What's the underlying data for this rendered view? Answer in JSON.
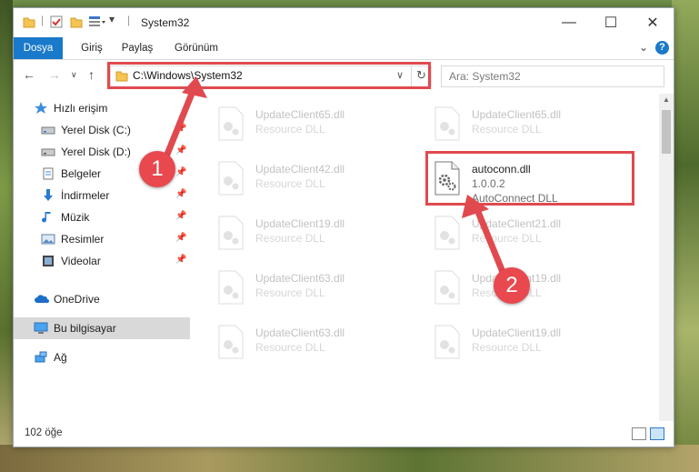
{
  "window": {
    "title": "System32",
    "controls": {
      "minimize": "—",
      "maximize": "☐",
      "close": "✕"
    }
  },
  "ribbon": {
    "tabs": [
      "Dosya",
      "Giriş",
      "Paylaş",
      "Görünüm"
    ]
  },
  "nav": {
    "address": "C:\\Windows\\System32",
    "search_placeholder": "Ara: System32"
  },
  "sidebar": {
    "items": [
      {
        "label": "Hızlı erişim",
        "icon": "star-icon"
      },
      {
        "label": "Yerel Disk (C:)",
        "icon": "drive-icon",
        "pinned": true
      },
      {
        "label": "Yerel Disk (D:)",
        "icon": "drive-icon",
        "pinned": true
      },
      {
        "label": "Belgeler",
        "icon": "documents-icon",
        "pinned": true
      },
      {
        "label": "İndirmeler",
        "icon": "download-icon",
        "pinned": true
      },
      {
        "label": "Müzik",
        "icon": "music-icon",
        "pinned": true
      },
      {
        "label": "Resimler",
        "icon": "pictures-icon",
        "pinned": true
      },
      {
        "label": "Videolar",
        "icon": "video-icon",
        "pinned": true
      },
      {
        "label": "OneDrive",
        "icon": "cloud-icon"
      },
      {
        "label": "Bu bilgisayar",
        "icon": "computer-icon",
        "selected": true
      },
      {
        "label": "Ağ",
        "icon": "network-icon"
      }
    ]
  },
  "files": {
    "left": [
      {
        "name": "UpdateClient65.dll",
        "type": "Resource DLL"
      },
      {
        "name": "UpdateClient42.dll",
        "type": "Resource DLL"
      },
      {
        "name": "UpdateClient19.dll",
        "type": "Resource DLL"
      },
      {
        "name": "UpdateClient63.dll",
        "type": "Resource DLL"
      },
      {
        "name": "UpdateClient63.dll",
        "type": "Resource DLL"
      }
    ],
    "right": [
      {
        "name": "UpdateClient65.dll",
        "type": "Resource DLL"
      },
      {
        "name": "UpdateClient21.dll",
        "type": "Resource DLL"
      },
      {
        "name": "UpdateClient19.dll",
        "type": "Resource DLL"
      },
      {
        "name": "UpdateClient19.dll",
        "type": "Resource DLL"
      }
    ],
    "highlighted": {
      "name": "autoconn.dll",
      "version": "1.0.0.2",
      "description": "AutoConnect DLL"
    }
  },
  "annotations": {
    "step1": "1",
    "step2": "2",
    "color": "#e04a4f"
  },
  "status": {
    "count": "102 öğe"
  }
}
